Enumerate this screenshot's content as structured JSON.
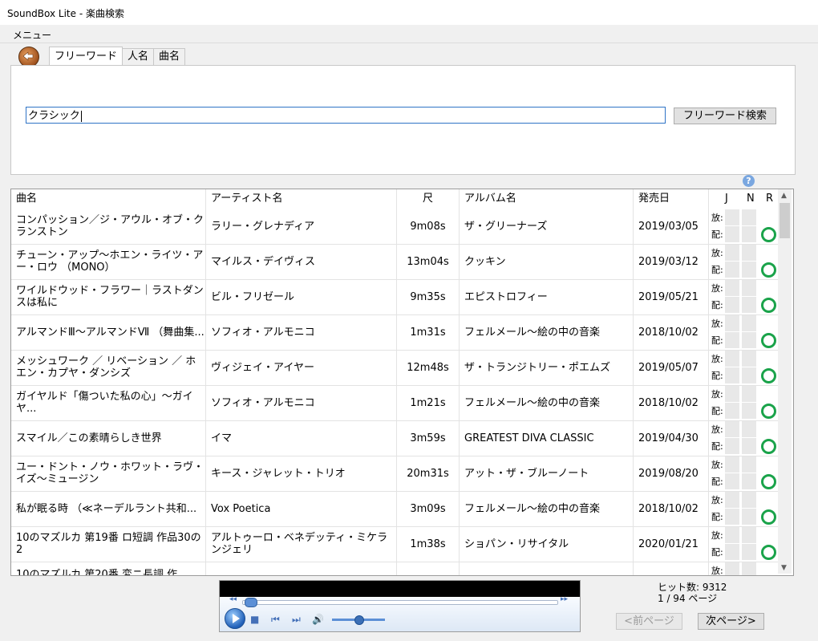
{
  "window": {
    "title": "SoundBox Lite - 楽曲検索"
  },
  "menu": {
    "label": "メニュー"
  },
  "tabs": [
    "フリーワード",
    "人名",
    "曲名"
  ],
  "search": {
    "value": "クラシック",
    "button": "フリーワード検索"
  },
  "help": {
    "icon": "help-icon",
    "text": "?"
  },
  "columns": {
    "title": "曲名",
    "artist": "アーティスト名",
    "length": "尺",
    "album": "アルバム名",
    "date": "発売日",
    "j": "J",
    "n": "N",
    "r": "R"
  },
  "labels": {
    "broadcast": "放:",
    "distribution": "配:"
  },
  "rows": [
    {
      "title": "コンパッション／ジ・アウル・オブ・クランストン",
      "artist": "ラリー・グレナディア",
      "length": "9m08s",
      "album": "ザ・グリーナーズ",
      "date": "2019/03/05"
    },
    {
      "title": "チューン・アップ〜ホエン・ライツ・アー・ロウ （MONO）",
      "artist": "マイルス・デイヴィス",
      "length": "13m04s",
      "album": "クッキン",
      "date": "2019/03/12"
    },
    {
      "title": "ワイルドウッド・フラワー｜ラストダンスは私に",
      "artist": "ビル・フリゼール",
      "length": "9m35s",
      "album": "エピストロフィー",
      "date": "2019/05/21"
    },
    {
      "title": "アルマンドⅢ〜アルマンドⅦ （舞曲集...",
      "artist": "ソフィオ・アルモニコ",
      "length": "1m31s",
      "album": "フェルメール〜絵の中の音楽",
      "date": "2018/10/02"
    },
    {
      "title": "メッシュワーク ／ リベーション ／ ホエン・カプヤ・ダンシズ",
      "artist": "ヴィジェイ・アイヤー",
      "length": "12m48s",
      "album": "ザ・トランジトリー・ポエムズ",
      "date": "2019/05/07"
    },
    {
      "title": "ガイヤルド「傷ついた私の心」〜ガイヤ...",
      "artist": "ソフィオ・アルモニコ",
      "length": "1m21s",
      "album": "フェルメール〜絵の中の音楽",
      "date": "2018/10/02"
    },
    {
      "title": "スマイル／この素晴らしき世界",
      "artist": "イマ",
      "length": "3m59s",
      "album": "GREATEST DIVA CLASSIC",
      "date": "2019/04/30"
    },
    {
      "title": "ユー・ドント・ノウ・ホワット・ラヴ・イズ〜ミュージン",
      "artist": "キース・ジャレット・トリオ",
      "length": "20m31s",
      "album": "アット・ザ・ブルーノート",
      "date": "2019/08/20"
    },
    {
      "title": "私が眠る時 （≪ネーデルラント共和...",
      "artist": "Vox Poetica",
      "length": "3m09s",
      "album": "フェルメール〜絵の中の音楽",
      "date": "2018/10/02"
    },
    {
      "title": "10のマズルカ 第19番 ロ短調 作品30の2",
      "artist": "アルトゥーロ・ベネデッティ・ミケランジェリ",
      "length": "1m38s",
      "album": "ショパン・リサイタル",
      "date": "2020/01/21"
    }
  ],
  "partial_row": {
    "title": "10のマズルカ 第20番 変ニ長調 作"
  },
  "status": {
    "hits": "ヒット数: 9312",
    "pages": "1 / 94 ページ"
  },
  "pager": {
    "prev": "<前ページ",
    "next": "次ページ>"
  },
  "colors": {
    "accent": "#2f74c6",
    "ring": "#1aa34a"
  }
}
